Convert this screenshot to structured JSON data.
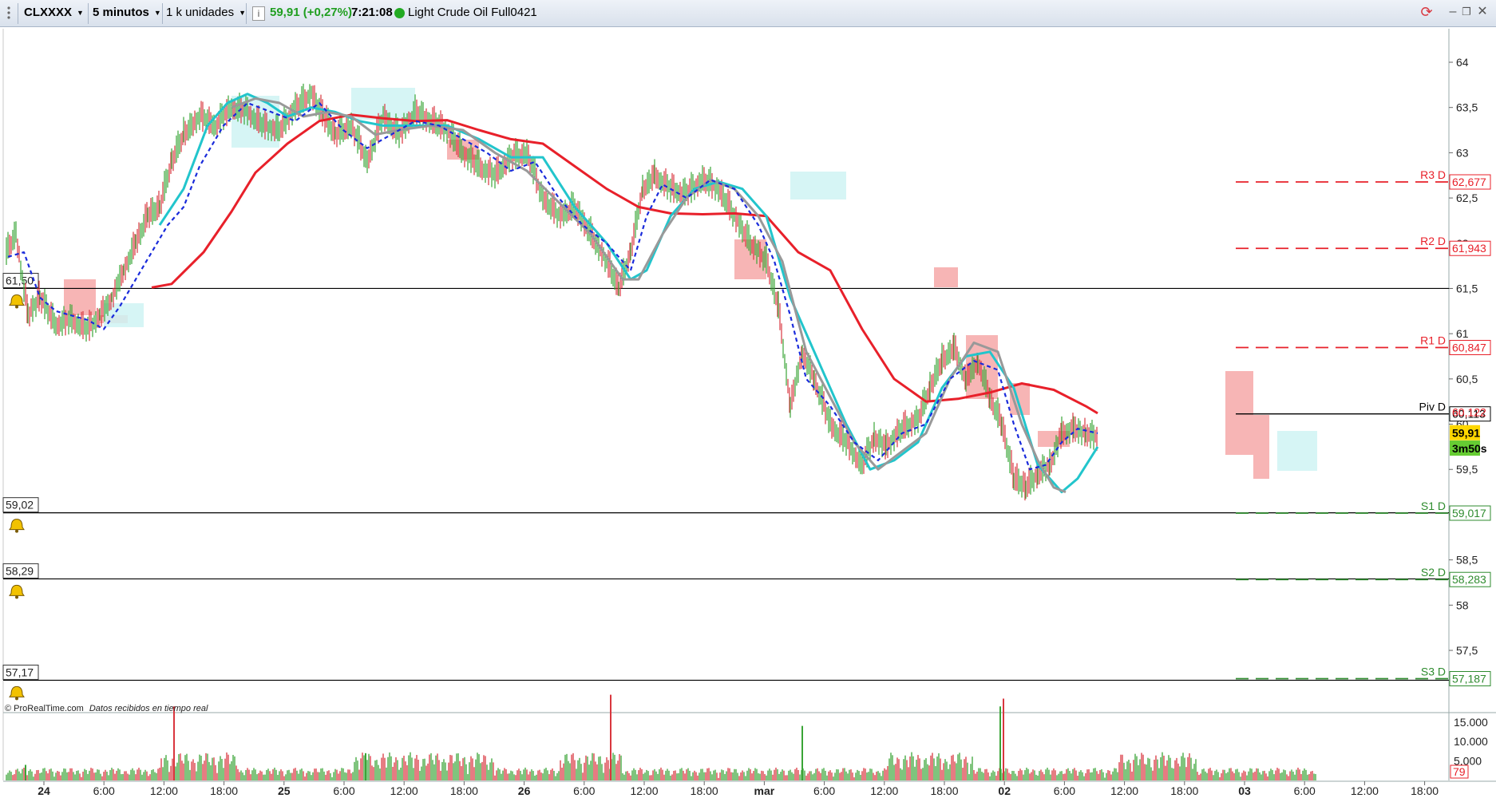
{
  "toolbar": {
    "symbol": "CLXXXX",
    "timeframe": "5 minutos",
    "units": "1 k unidades",
    "info_icon": "info-icon",
    "price_change": "59,91 (+0,27%)",
    "time": "7:21:08",
    "status_color": "#22aa22",
    "instrument": "Light Crude Oil Full0421"
  },
  "chart_data": {
    "type": "line",
    "title": "Light Crude Oil Full0421",
    "price_axis": {
      "ticks": [
        "64",
        "63,5",
        "63",
        "62,5",
        "62",
        "61,5",
        "61",
        "60,5",
        "60",
        "59,5",
        "59",
        "58,5",
        "58",
        "57,5"
      ],
      "tick_values": [
        64,
        63.5,
        63,
        62.5,
        62,
        61.5,
        61,
        60.5,
        60,
        59.5,
        59,
        58.5,
        58,
        57.5
      ],
      "ylim": [
        57.1,
        64.4
      ]
    },
    "time_axis": {
      "labels": [
        "24",
        "6:00",
        "12:00",
        "18:00",
        "25",
        "6:00",
        "12:00",
        "18:00",
        "26",
        "6:00",
        "12:00",
        "18:00",
        "mar",
        "6:00",
        "12:00",
        "18:00",
        "02",
        "6:00",
        "12:00",
        "18:00",
        "03",
        "6:00",
        "12:00",
        "18:00"
      ],
      "bold": [
        true,
        false,
        false,
        false,
        true,
        false,
        false,
        false,
        true,
        false,
        false,
        false,
        true,
        false,
        false,
        false,
        true,
        false,
        false,
        false,
        true,
        false,
        false,
        false
      ]
    },
    "pivot_levels": [
      {
        "name": "R3 D",
        "value": "62,677",
        "color": "#e8202a",
        "style": "dashed",
        "y": 62.677
      },
      {
        "name": "R2 D",
        "value": "61,943",
        "color": "#e8202a",
        "style": "dashed",
        "y": 61.943
      },
      {
        "name": "R1 D",
        "value": "60,847",
        "color": "#e8202a",
        "style": "dashed",
        "y": 60.847
      },
      {
        "name": "Piv D",
        "value": "60,113",
        "color": "#000000",
        "style": "solid",
        "y": 60.113
      },
      {
        "name": "S1 D",
        "value": "59,017",
        "color": "#2e8b2e",
        "style": "dashed",
        "y": 59.017
      },
      {
        "name": "S2 D",
        "value": "58,283",
        "color": "#2e8b2e",
        "style": "dashed",
        "y": 58.283
      },
      {
        "name": "S3 D",
        "value": "57,187",
        "color": "#2e8b2e",
        "style": "dashed",
        "y": 57.187
      }
    ],
    "extra_price_labels": [
      {
        "value": "60,122",
        "color": "#e8202a",
        "y": 60.122
      },
      {
        "value": "59,91",
        "bg": "#ffd700",
        "y": 59.91
      },
      {
        "value": "3m50s",
        "bg": "#66cc33",
        "y": 59.74
      }
    ],
    "alert_lines": [
      {
        "value": "61,50",
        "y": 61.5
      },
      {
        "value": "59,02",
        "y": 59.02
      },
      {
        "value": "58,29",
        "y": 58.29
      },
      {
        "value": "57,17",
        "y": 57.17
      }
    ],
    "series": [
      {
        "name": "moving-average-red",
        "color": "#e8202a",
        "x": [
          190,
          215,
          255,
          290,
          320,
          360,
          400,
          440,
          480,
          520,
          560,
          600,
          640,
          680,
          720,
          760,
          800,
          840,
          880,
          920,
          960,
          1000,
          1040,
          1080,
          1120,
          1160,
          1200,
          1240,
          1280,
          1320,
          1360,
          1375
        ],
        "y": [
          61.51,
          61.55,
          61.9,
          62.35,
          62.78,
          63.1,
          63.35,
          63.42,
          63.38,
          63.35,
          63.36,
          63.25,
          63.15,
          63.1,
          62.85,
          62.6,
          62.4,
          62.33,
          62.32,
          62.33,
          62.3,
          61.9,
          61.7,
          61.05,
          60.5,
          60.25,
          60.28,
          60.35,
          60.45,
          60.38,
          60.2,
          60.12
        ]
      },
      {
        "name": "moving-average-cyan",
        "color": "#22c5cc",
        "x": [
          200,
          230,
          260,
          285,
          310,
          335,
          360,
          390,
          420,
          450,
          480,
          520,
          560,
          600,
          640,
          680,
          720,
          760,
          790,
          810,
          840,
          870,
          900,
          930,
          960,
          990,
          1020,
          1060,
          1090,
          1120,
          1150,
          1180,
          1210,
          1240,
          1270,
          1300,
          1330,
          1350,
          1375
        ],
        "y": [
          62.2,
          62.6,
          63.3,
          63.55,
          63.65,
          63.55,
          63.4,
          63.5,
          63.45,
          63.35,
          63.3,
          63.3,
          63.3,
          63.15,
          62.95,
          62.95,
          62.4,
          62.0,
          61.6,
          61.7,
          62.3,
          62.6,
          62.68,
          62.6,
          62.3,
          61.4,
          60.8,
          60.0,
          59.5,
          59.6,
          59.8,
          60.4,
          60.75,
          60.8,
          60.4,
          59.55,
          59.25,
          59.4,
          59.75
        ]
      },
      {
        "name": "moving-average-gray",
        "color": "#999999",
        "x": [
          290,
          320,
          350,
          380,
          410,
          440,
          470,
          500,
          540,
          580,
          620,
          660,
          700,
          740,
          780,
          800,
          830,
          860,
          890,
          920,
          950,
          980,
          1010,
          1040,
          1070,
          1100,
          1130,
          1160,
          1190,
          1220,
          1250,
          1280,
          1300,
          1320,
          1335
        ],
        "y": [
          63.5,
          63.6,
          63.55,
          63.4,
          63.45,
          63.4,
          63.2,
          63.25,
          63.3,
          63.25,
          63.0,
          62.8,
          62.45,
          62.1,
          61.6,
          61.6,
          62.1,
          62.5,
          62.7,
          62.6,
          62.3,
          61.8,
          60.8,
          60.3,
          59.8,
          59.5,
          59.7,
          59.9,
          60.5,
          60.9,
          60.8,
          60.0,
          59.6,
          59.3,
          59.25
        ]
      },
      {
        "name": "moving-average-blue-dashed",
        "color": "#1a2bdb",
        "x": [
          10,
          30,
          50,
          70,
          90,
          110,
          130,
          150,
          170,
          190,
          210,
          230,
          250,
          280,
          310,
          340,
          370,
          400,
          430,
          460,
          490,
          520,
          550,
          580,
          610,
          640,
          670,
          700,
          730,
          760,
          790,
          810,
          830,
          860,
          890,
          920,
          950,
          970,
          990,
          1010,
          1040,
          1070,
          1100,
          1130,
          1160,
          1190,
          1220,
          1250,
          1270,
          1290,
          1310,
          1330,
          1350,
          1375
        ],
        "y": [
          61.85,
          61.9,
          61.4,
          61.25,
          61.2,
          61.15,
          61.05,
          61.3,
          61.6,
          61.9,
          62.2,
          62.4,
          62.85,
          63.3,
          63.55,
          63.45,
          63.35,
          63.55,
          63.25,
          63.05,
          63.2,
          63.35,
          63.3,
          63.15,
          63.0,
          62.8,
          62.9,
          62.5,
          62.2,
          62.0,
          61.7,
          62.3,
          62.65,
          62.5,
          62.7,
          62.6,
          62.2,
          61.8,
          61.2,
          60.5,
          60.2,
          59.8,
          59.6,
          59.9,
          60.0,
          60.5,
          60.7,
          60.6,
          60.0,
          59.5,
          59.55,
          59.8,
          59.95,
          59.9
        ]
      },
      {
        "name": "price-candles",
        "color": "#55aa33",
        "x": [
          8,
          20,
          35,
          50,
          70,
          90,
          110,
          125,
          140,
          155,
          170,
          185,
          200,
          215,
          230,
          250,
          270,
          290,
          310,
          330,
          350,
          370,
          390,
          405,
          420,
          440,
          460,
          480,
          500,
          520,
          540,
          560,
          580,
          600,
          620,
          640,
          660,
          680,
          700,
          720,
          740,
          760,
          775,
          790,
          805,
          820,
          840,
          860,
          880,
          900,
          920,
          940,
          960,
          975,
          990,
          1005,
          1020,
          1040,
          1060,
          1080,
          1095,
          1110,
          1130,
          1150,
          1165,
          1180,
          1195,
          1210,
          1225,
          1240,
          1255,
          1270,
          1285,
          1300,
          1315,
          1330,
          1345,
          1360,
          1375
        ],
        "y": [
          61.9,
          62.1,
          61.2,
          61.4,
          61.1,
          61.15,
          61.05,
          61.2,
          61.4,
          61.7,
          62.0,
          62.3,
          62.4,
          62.9,
          63.2,
          63.4,
          63.3,
          63.5,
          63.45,
          63.3,
          63.25,
          63.5,
          63.65,
          63.4,
          63.2,
          63.3,
          62.9,
          63.4,
          63.2,
          63.45,
          63.35,
          63.25,
          63.0,
          62.85,
          62.75,
          62.95,
          63.0,
          62.5,
          62.3,
          62.4,
          62.1,
          61.8,
          61.5,
          61.9,
          62.6,
          62.75,
          62.6,
          62.55,
          62.7,
          62.6,
          62.3,
          62.0,
          61.8,
          61.3,
          60.2,
          60.8,
          60.5,
          60.0,
          59.8,
          59.55,
          59.85,
          59.75,
          59.95,
          60.05,
          60.4,
          60.7,
          60.85,
          60.5,
          60.7,
          60.3,
          60.0,
          59.4,
          59.3,
          59.45,
          59.55,
          59.9,
          59.95,
          59.9,
          59.85
        ]
      }
    ],
    "volume": {
      "ticks": [
        "15.000",
        "10.000",
        "5.000"
      ],
      "tick_values": [
        15000,
        10000,
        5000
      ],
      "current": "79",
      "spikes_x": [
        32,
        218,
        458,
        765,
        1005,
        1257,
        1253
      ],
      "spikes_v": [
        4000,
        19000,
        7000,
        22000,
        14000,
        21000,
        19000
      ]
    }
  },
  "footer": {
    "copyright": "© ProRealTime.com",
    "realtime": "Datos recibidos en tiempo real"
  },
  "window": {
    "icons": [
      "sync-icon",
      "minimize-icon",
      "restore-icon",
      "close-icon"
    ]
  },
  "colors": {
    "up": "#3aa537",
    "down": "#d9363e",
    "cloud_bear": "#f6a8a8",
    "cloud_bull": "#cff3f3"
  }
}
